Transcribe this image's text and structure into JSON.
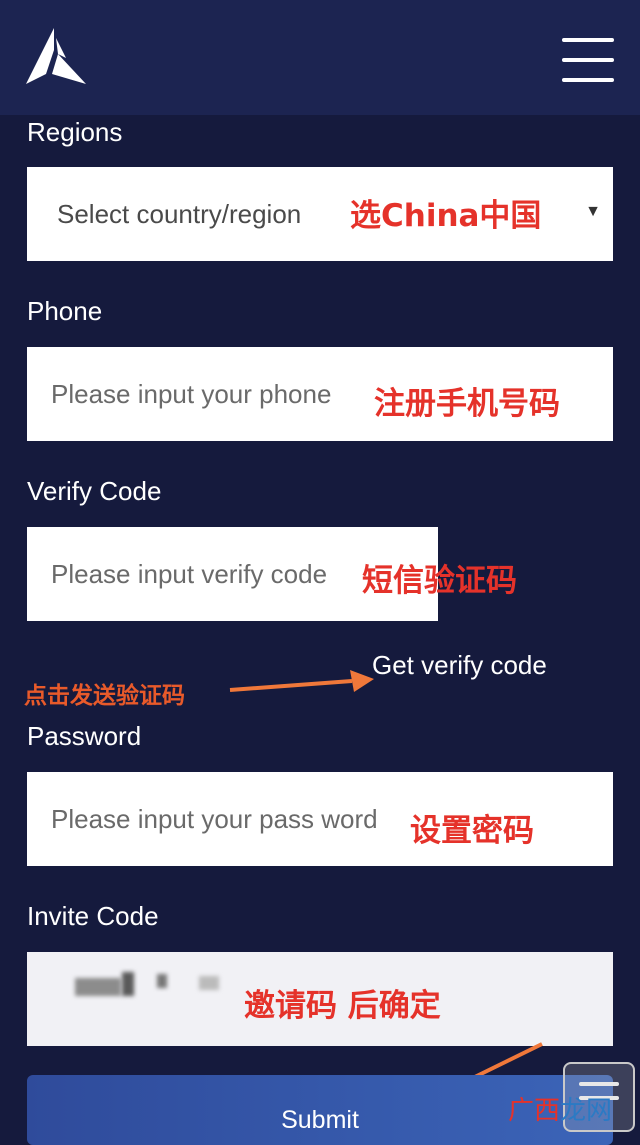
{
  "header": {
    "logo_icon": "triangle-logo-icon",
    "menu_icon": "hamburger-menu-icon"
  },
  "regions": {
    "label": "Regions",
    "placeholder": "Select country/region",
    "annotation": "选China中国",
    "arrow_glyph": "▼"
  },
  "phone": {
    "label": "Phone",
    "placeholder": "Please input your phone",
    "annotation": "注册手机号码"
  },
  "verify": {
    "label": "Verify Code",
    "placeholder": "Please input verify code",
    "annotation": "短信验证码",
    "get_code_label": "Get verify code",
    "get_code_annotation": "点击发送验证码"
  },
  "password": {
    "label": "Password",
    "placeholder": "Please input your pass word",
    "annotation": "设置密码"
  },
  "invite": {
    "label": "Invite Code",
    "annotation": "邀请码 后确定"
  },
  "submit": {
    "label": "Submit"
  },
  "watermark": {
    "part1": "广西",
    "part2": "龙网"
  },
  "colors": {
    "background": "#151a3d",
    "header": "#1c2451",
    "annotation_red": "#e5322a",
    "arrow_orange": "#f0783a",
    "submit_button": "#3b64b8"
  }
}
